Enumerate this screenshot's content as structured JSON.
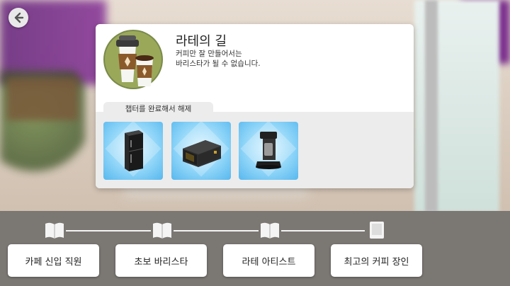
{
  "aspiration": {
    "title": "라테의 길",
    "description": "커피만 잘 만들어서는\n바리스타가 될 수 없습니다.",
    "unlock_label": "챕터를 완료해서 해제",
    "rewards": [
      {
        "icon": "refrigerator-icon"
      },
      {
        "icon": "microwave-icon"
      },
      {
        "icon": "coffee-maker-icon"
      }
    ]
  },
  "levels": [
    {
      "label": "카페 신입 직원",
      "icon": "open-book-icon"
    },
    {
      "label": "초보 바리스타",
      "icon": "open-book-icon"
    },
    {
      "label": "라테 아티스트",
      "icon": "open-book-icon"
    },
    {
      "label": "최고의 커피 장인",
      "icon": "closed-book-icon"
    }
  ],
  "colors": {
    "reward_tile": "#8fd5f8",
    "bottom_bar": "#7b7773",
    "card": "#ffffff"
  }
}
